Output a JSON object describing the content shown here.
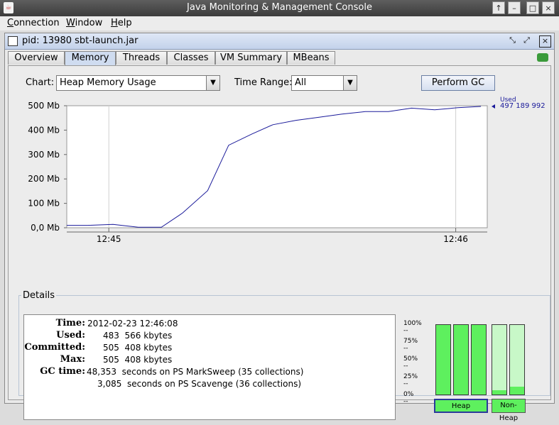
{
  "window": {
    "title": "Java Monitoring & Management Console"
  },
  "menu": {
    "items": [
      {
        "label": "Connection"
      },
      {
        "label": "Window"
      },
      {
        "label": "Help"
      }
    ]
  },
  "process": {
    "title": "pid: 13980 sbt-launch.jar"
  },
  "tabs": [
    {
      "label": "Overview"
    },
    {
      "label": "Memory"
    },
    {
      "label": "Threads"
    },
    {
      "label": "Classes"
    },
    {
      "label": "VM Summary"
    },
    {
      "label": "MBeans"
    }
  ],
  "controls": {
    "chart_label": "Chart:",
    "chart_value": "Heap Memory Usage",
    "time_range_label": "Time Range:",
    "time_range_value": "All",
    "perform_gc_label": "Perform GC"
  },
  "chart_data": {
    "type": "line",
    "ylabel_ticks": [
      "0,0 Mb",
      "100 Mb",
      "200 Mb",
      "300 Mb",
      "400 Mb",
      "500 Mb"
    ],
    "ylim": [
      0,
      500
    ],
    "x_ticks": [
      "12:45",
      "12:46"
    ],
    "x_tick_positions": [
      0.1,
      0.925
    ],
    "series": [
      {
        "name": "Used",
        "x": [
          0,
          0.05,
          0.11,
          0.17,
          0.225,
          0.275,
          0.335,
          0.385,
          0.44,
          0.49,
          0.545,
          0.6,
          0.655,
          0.71,
          0.765,
          0.82,
          0.875,
          0.93,
          0.985
        ],
        "values": [
          10,
          10,
          14,
          2,
          2,
          60,
          152,
          338,
          384,
          422,
          440,
          453,
          466,
          476,
          476,
          490,
          483,
          492,
          497
        ]
      }
    ],
    "legend": {
      "label": "Used",
      "value": "497 189 992"
    },
    "line_color": "#1a1a9a"
  },
  "details": {
    "title": "Details",
    "rows": [
      {
        "key": "Time:",
        "value": "2012-02-23 12:46:08"
      },
      {
        "key": "Used:",
        "value": "483  566 kbytes"
      },
      {
        "key": "Committed:",
        "value": "505  408 kbytes"
      },
      {
        "key": "Max:",
        "value": "505  408 kbytes"
      },
      {
        "key": "GC time:",
        "value": "48,353  seconds on PS MarkSweep (35 collections)"
      },
      {
        "key": "",
        "value": "3,085  seconds on PS Scavenge (36 collections)"
      }
    ]
  },
  "pools": {
    "ticks": [
      "100% --",
      "75% --",
      "50% --",
      "25% --",
      "0% --"
    ],
    "heap_bars": [
      1.0,
      1.0,
      1.0
    ],
    "nonheap_bars": [
      0.06,
      0.11
    ],
    "heap_label": "Heap",
    "nonheap_label": "Non-Heap"
  }
}
